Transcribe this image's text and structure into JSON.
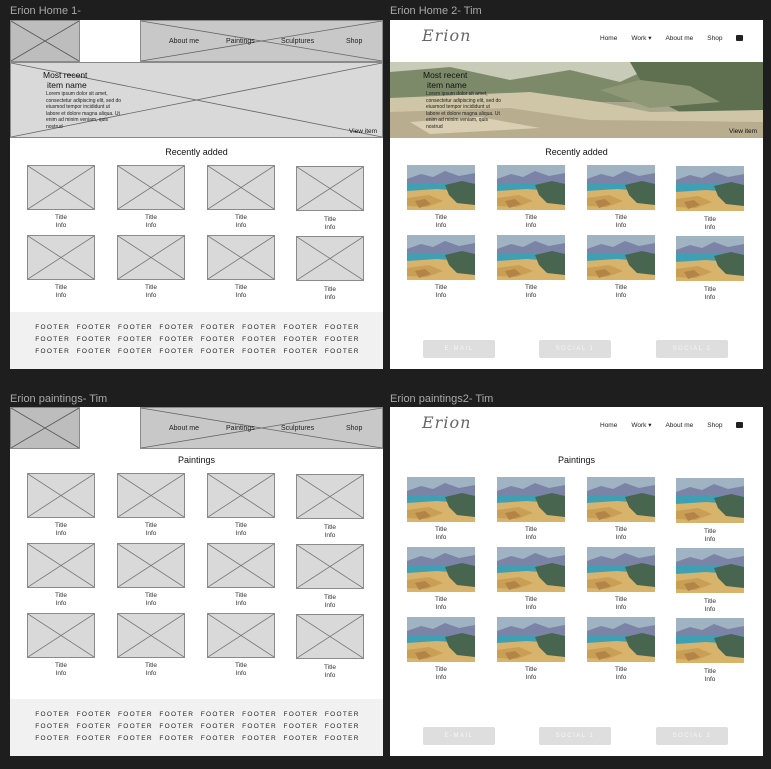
{
  "frames": {
    "home_wire": "Erion Home 1-",
    "home_hifi": "Erion Home 2- Tim",
    "paint_wire": "Erion paintings- Tim",
    "paint_hifi": "Erion paintings2- Tim"
  },
  "nav": {
    "about": "About me",
    "paintings": "Paintings",
    "sculptures": "Sculptures",
    "shop": "Shop",
    "home": "Home",
    "work": "Work ▾"
  },
  "brand": {
    "logo": "Erion"
  },
  "hero": {
    "line1": "Most recent",
    "line2": "item name",
    "body_1": "Lorem ipsum dolor sit amet,",
    "body_2": "consectetur adipiscing elit, sed do",
    "body_3": "eiusmod tempor incididunt ut",
    "body_4": "labore et dolore magna aliqua. Ut",
    "body_5": "enim ad minim veniam, quis",
    "body_6": "nostrud",
    "view": "View item"
  },
  "sections": {
    "recent": "Recently added",
    "paintings": "Paintings"
  },
  "card": {
    "title": "Title",
    "info": "Info"
  },
  "footer": {
    "label": "FOOTER"
  },
  "social": {
    "email": "E-MAIL",
    "social1": "SOCIAL 1",
    "social2": "SOCIAL 2"
  },
  "colors": {
    "background": "#1e1e1e",
    "placeholder": "#d9d9d9",
    "footer_bg": "#f1f1f1",
    "button": "#dedede"
  }
}
